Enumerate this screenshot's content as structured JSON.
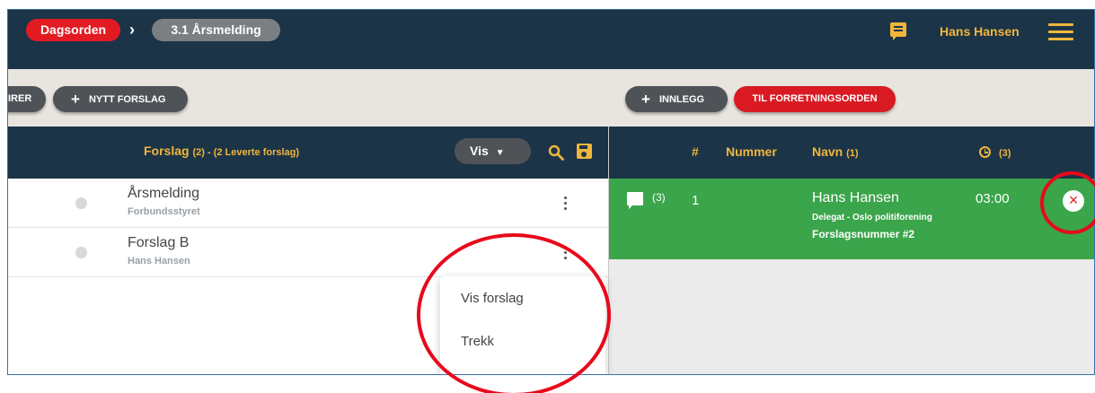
{
  "breadcrumb": {
    "root": "Dagsorden",
    "separator": "›",
    "current": "3.1 Årsmelding"
  },
  "header": {
    "message_icon": "message-icon",
    "user_name": "Hans Hansen",
    "menu_icon": "hamburger-icon"
  },
  "actions": {
    "cut_label": "IRER",
    "new_proposal_label": "NYTT FORSLAG",
    "plus": "+",
    "innlegg_label": "INNLEGG",
    "til_label": "TIL FORRETNINGSORDEN"
  },
  "proposals": {
    "title": "Forslag",
    "count_text": "(2) - (2 Leverte forslag)",
    "vis_label": "Vis",
    "vis_caret": "▼",
    "items": [
      {
        "title": "Årsmelding",
        "subtitle": "Forbundsstyret"
      },
      {
        "title": "Forslag B",
        "subtitle": "Hans Hansen"
      }
    ]
  },
  "context_menu": {
    "items": [
      "Vis forslag",
      "Trekk"
    ]
  },
  "speakers": {
    "columns": {
      "hash": "#",
      "nummer": "Nummer",
      "navn": "Navn",
      "navn_count": "(1)",
      "time_count": "(3)"
    },
    "entry": {
      "comment_count": "(3)",
      "position": "1",
      "name": "Hans Hansen",
      "role": "Delegat - Oslo politiforening",
      "proposal_ref": "Forslagsnummer #2",
      "time": "03:00",
      "remove_symbol": "×"
    }
  },
  "colors": {
    "navy": "#1c3447",
    "accent": "#f0b63a",
    "red": "#e21b22",
    "green": "#3aa54a",
    "annotation": "#e8091b"
  }
}
